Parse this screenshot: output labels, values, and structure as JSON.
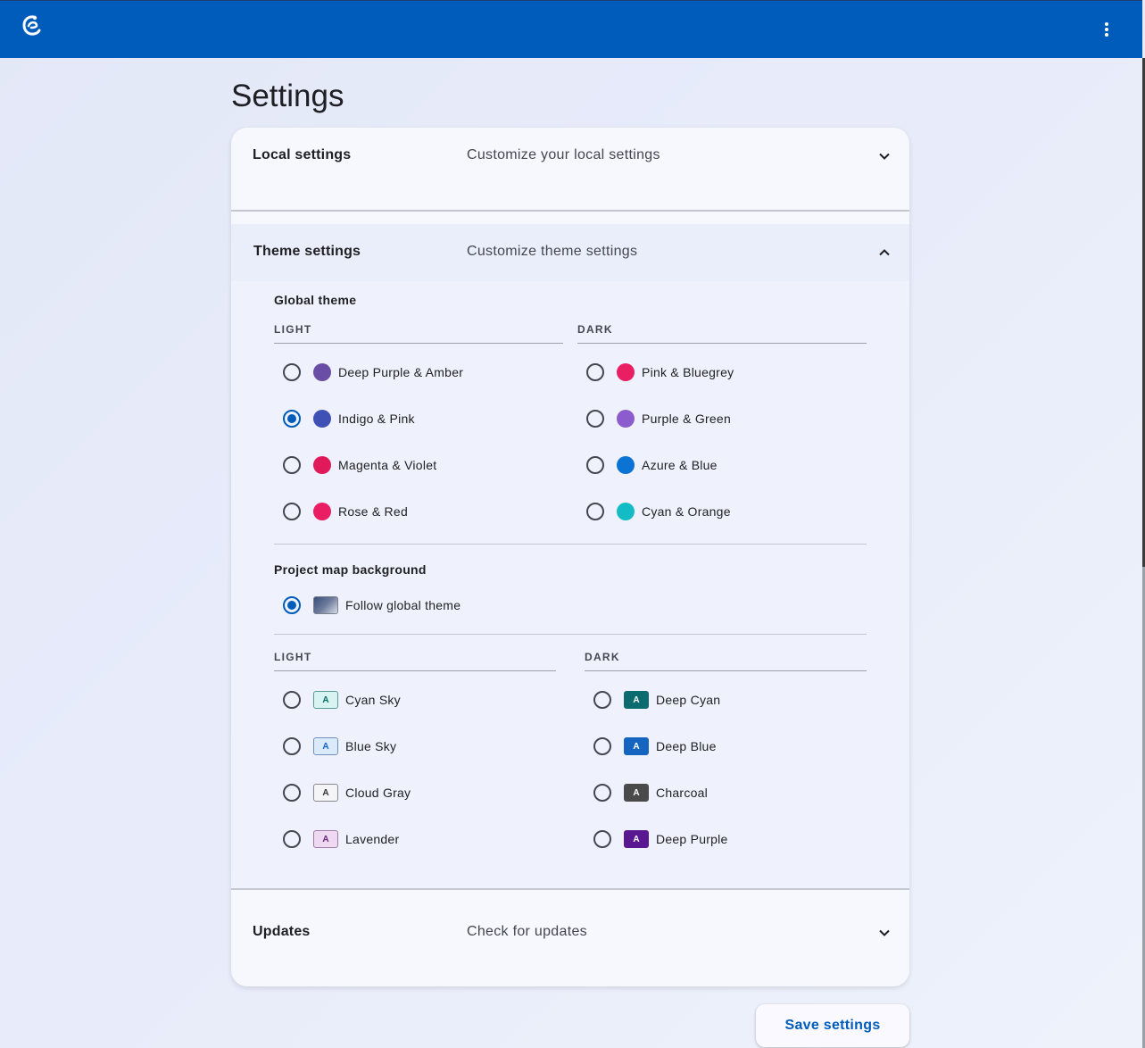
{
  "app": {
    "logo_icon": "stylized-e-logo-icon",
    "menu_icon": "more-vertical-icon",
    "brand_color": "#005cbb"
  },
  "page": {
    "title": "Settings"
  },
  "panels": {
    "local": {
      "title": "Local settings",
      "description": "Customize your local settings",
      "expanded": false
    },
    "theme": {
      "title": "Theme settings",
      "description": "Customize theme settings",
      "expanded": true
    },
    "updates": {
      "title": "Updates",
      "description": "Check for updates",
      "expanded": false
    }
  },
  "global_theme": {
    "label": "Global theme",
    "light_heading": "LIGHT",
    "dark_heading": "DARK",
    "selected": "Indigo & Pink",
    "light": [
      {
        "label": "Deep Purple & Amber",
        "color": "#6a4ea6"
      },
      {
        "label": "Indigo & Pink",
        "color": "#3f51b5"
      },
      {
        "label": "Magenta & Violet",
        "color": "#e0195a"
      },
      {
        "label": "Rose & Red",
        "color": "#e91e63"
      }
    ],
    "dark": [
      {
        "label": "Pink & Bluegrey",
        "color": "#e91e63"
      },
      {
        "label": "Purple & Green",
        "color": "#8c5ccf"
      },
      {
        "label": "Azure & Blue",
        "color": "#0b73d4"
      },
      {
        "label": "Cyan & Orange",
        "color": "#13bcc5"
      }
    ]
  },
  "project_map": {
    "label": "Project map background",
    "follow_label": "Follow global theme",
    "follow_selected": true,
    "light_heading": "LIGHT",
    "dark_heading": "DARK",
    "swatch_letter": "A",
    "light": [
      {
        "label": "Cyan Sky",
        "bg": "#d8f4f2",
        "fg": "#0a6b66",
        "border": "#5a9a96"
      },
      {
        "label": "Blue Sky",
        "bg": "#dbeafb",
        "fg": "#1565c0",
        "border": "#6f90b8"
      },
      {
        "label": "Cloud Gray",
        "bg": "#f5f5f7",
        "fg": "#333333",
        "border": "#8a8a8e"
      },
      {
        "label": "Lavender",
        "bg": "#efd8f1",
        "fg": "#6a2a78",
        "border": "#9f7aa6"
      }
    ],
    "dark": [
      {
        "label": "Deep Cyan",
        "bg": "#0b6b6e",
        "fg": "#ffffff",
        "border": "#0b6b6e"
      },
      {
        "label": "Deep Blue",
        "bg": "#1565c0",
        "fg": "#ffffff",
        "border": "#1565c0"
      },
      {
        "label": "Charcoal",
        "bg": "#4a4a4a",
        "fg": "#ffffff",
        "border": "#4a4a4a"
      },
      {
        "label": "Deep Purple",
        "bg": "#5a1890",
        "fg": "#ffffff",
        "border": "#5a1890"
      }
    ]
  },
  "actions": {
    "save_label": "Save settings"
  }
}
